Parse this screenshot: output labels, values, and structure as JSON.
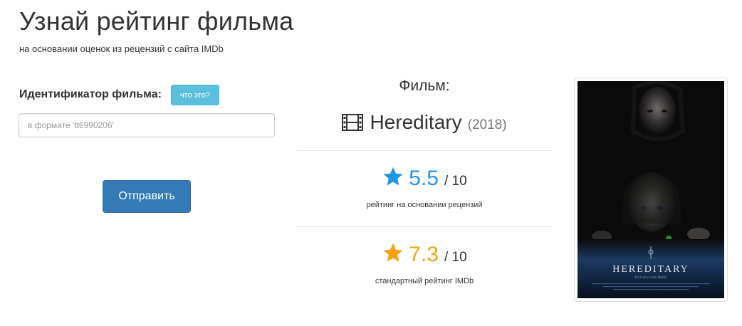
{
  "header": {
    "title": "Узнай рейтинг фильма",
    "subtitle": "на основании оценок из рецензий с сайта IMDb"
  },
  "form": {
    "label": "Идентификатор фильма:",
    "help_label": "что это?",
    "input_placeholder": "в формате 'tt6990206'",
    "input_value": "",
    "submit_label": "Отправить"
  },
  "result": {
    "heading": "Фильм:",
    "film_icon": "film-icon",
    "film_name": "Hereditary",
    "film_year": "(2018)",
    "review_rating": {
      "value": "5.5",
      "max": "/ 10",
      "caption": "рейтинг на основании рецензий",
      "icon": "star-icon",
      "color": "#2196e3"
    },
    "imdb_rating": {
      "value": "7.3",
      "max": "/ 10",
      "caption": "стандартный рейтинг IMDb",
      "icon": "star-icon",
      "color": "#f5a30f"
    }
  },
  "poster": {
    "title": "HEREDITARY",
    "tagline": "Evil runs in the family"
  }
}
